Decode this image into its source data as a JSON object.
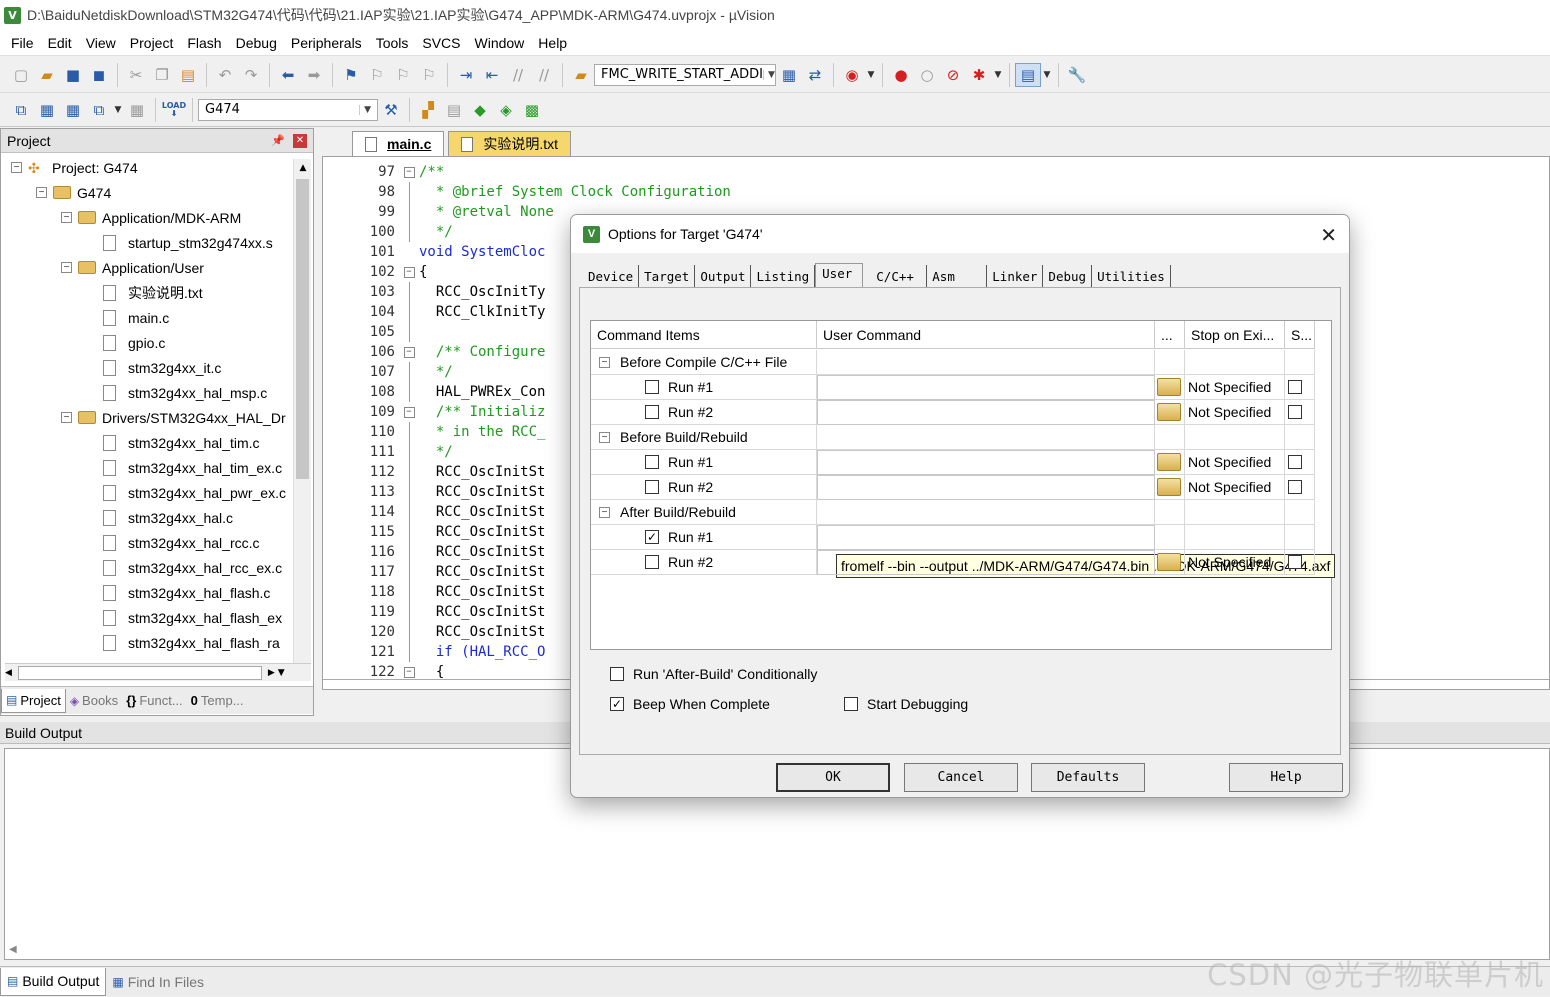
{
  "window": {
    "title": "D:\\BaiduNetdiskDownload\\STM32G474\\代码\\代码\\21.IAP实验\\21.IAP实验\\G474_APP\\MDK-ARM\\G474.uvprojx - µVision",
    "icon": "V"
  },
  "menu": [
    "File",
    "Edit",
    "View",
    "Project",
    "Flash",
    "Debug",
    "Peripherals",
    "Tools",
    "SVCS",
    "Window",
    "Help"
  ],
  "toolbar": {
    "search_combo": "FMC_WRITE_START_ADDI",
    "target_combo": "G474",
    "load_label": "LOAD"
  },
  "project_pane": {
    "title": "Project",
    "tree": [
      {
        "label": "Project: G474",
        "level": 0,
        "kind": "project",
        "expander": "-"
      },
      {
        "label": "G474",
        "level": 1,
        "kind": "target",
        "expander": "-"
      },
      {
        "label": "Application/MDK-ARM",
        "level": 2,
        "kind": "folder",
        "expander": "-"
      },
      {
        "label": "startup_stm32g474xx.s",
        "level": 3,
        "kind": "file"
      },
      {
        "label": "Application/User",
        "level": 2,
        "kind": "folder",
        "expander": "-"
      },
      {
        "label": "实验说明.txt",
        "level": 3,
        "kind": "file"
      },
      {
        "label": "main.c",
        "level": 3,
        "kind": "file"
      },
      {
        "label": "gpio.c",
        "level": 3,
        "kind": "file"
      },
      {
        "label": "stm32g4xx_it.c",
        "level": 3,
        "kind": "file"
      },
      {
        "label": "stm32g4xx_hal_msp.c",
        "level": 3,
        "kind": "file"
      },
      {
        "label": "Drivers/STM32G4xx_HAL_Dr",
        "level": 2,
        "kind": "folder",
        "expander": "-"
      },
      {
        "label": "stm32g4xx_hal_tim.c",
        "level": 3,
        "kind": "file"
      },
      {
        "label": "stm32g4xx_hal_tim_ex.c",
        "level": 3,
        "kind": "file"
      },
      {
        "label": "stm32g4xx_hal_pwr_ex.c",
        "level": 3,
        "kind": "file"
      },
      {
        "label": "stm32g4xx_hal.c",
        "level": 3,
        "kind": "file"
      },
      {
        "label": "stm32g4xx_hal_rcc.c",
        "level": 3,
        "kind": "file"
      },
      {
        "label": "stm32g4xx_hal_rcc_ex.c",
        "level": 3,
        "kind": "file"
      },
      {
        "label": "stm32g4xx_hal_flash.c",
        "level": 3,
        "kind": "file"
      },
      {
        "label": "stm32g4xx_hal_flash_ex",
        "level": 3,
        "kind": "file"
      },
      {
        "label": "stm32g4xx_hal_flash_ra",
        "level": 3,
        "kind": "file"
      }
    ],
    "tabs": [
      "Project",
      "Books",
      "Funct...",
      "Temp..."
    ]
  },
  "editor": {
    "tabs": [
      {
        "label": "main.c",
        "active": true
      },
      {
        "label": "实验说明.txt",
        "active": false
      }
    ],
    "lines": [
      {
        "n": "97",
        "fold": "box",
        "text": "/**",
        "cls": "com"
      },
      {
        "n": "98",
        "fold": "line",
        "text": "  * @brief System Clock Configuration",
        "cls": "com"
      },
      {
        "n": "99",
        "fold": "line",
        "text": "  * @retval None",
        "cls": "com"
      },
      {
        "n": "100",
        "fold": "end",
        "text": "  */",
        "cls": "com"
      },
      {
        "n": "101",
        "fold": "",
        "text": "void SystemCloc",
        "cls": "kwline"
      },
      {
        "n": "102",
        "fold": "box",
        "text": "{",
        "cls": ""
      },
      {
        "n": "103",
        "fold": "line",
        "text": "  RCC_OscInitTy",
        "cls": ""
      },
      {
        "n": "104",
        "fold": "line",
        "text": "  RCC_ClkInitTy",
        "cls": ""
      },
      {
        "n": "105",
        "fold": "line",
        "text": "",
        "cls": ""
      },
      {
        "n": "106",
        "fold": "box",
        "text": "  /** Configure",
        "cls": "com"
      },
      {
        "n": "107",
        "fold": "line",
        "text": "  */",
        "cls": "com"
      },
      {
        "n": "108",
        "fold": "line",
        "text": "  HAL_PWREx_Con",
        "cls": ""
      },
      {
        "n": "109",
        "fold": "box",
        "text": "  /** Initializ",
        "cls": "com"
      },
      {
        "n": "110",
        "fold": "line",
        "text": "  * in the RCC_",
        "cls": "com"
      },
      {
        "n": "111",
        "fold": "line",
        "text": "  */",
        "cls": "com"
      },
      {
        "n": "112",
        "fold": "line",
        "text": "  RCC_OscInitSt",
        "cls": ""
      },
      {
        "n": "113",
        "fold": "line",
        "text": "  RCC_OscInitSt",
        "cls": ""
      },
      {
        "n": "114",
        "fold": "line",
        "text": "  RCC_OscInitSt",
        "cls": ""
      },
      {
        "n": "115",
        "fold": "line",
        "text": "  RCC_OscInitSt",
        "cls": ""
      },
      {
        "n": "116",
        "fold": "line",
        "text": "  RCC_OscInitSt",
        "cls": ""
      },
      {
        "n": "117",
        "fold": "line",
        "text": "  RCC_OscInitSt",
        "cls": ""
      },
      {
        "n": "118",
        "fold": "line",
        "text": "  RCC_OscInitSt",
        "cls": ""
      },
      {
        "n": "119",
        "fold": "line",
        "text": "  RCC_OscInitSt",
        "cls": ""
      },
      {
        "n": "120",
        "fold": "line",
        "text": "  RCC_OscInitSt",
        "cls": ""
      },
      {
        "n": "121",
        "fold": "line",
        "text": "  if (HAL_RCC_O",
        "cls": "kwline"
      },
      {
        "n": "122",
        "fold": "box",
        "text": "  {",
        "cls": ""
      }
    ]
  },
  "build_output": {
    "title": "Build Output",
    "tabs": [
      "Build Output",
      "Find In Files"
    ]
  },
  "watermark": "CSDN @光子物联单片机",
  "dialog": {
    "title": "Options for Target 'G474'",
    "tabs": [
      "Device",
      "Target",
      "Output",
      "Listing",
      "User",
      "C/C++",
      "Asm",
      "Linker",
      "Debug",
      "Utilities"
    ],
    "active_tab": "User",
    "columns": [
      "Command Items",
      "User Command",
      "...",
      "Stop on Exi...",
      "S..."
    ],
    "rows": [
      {
        "kind": "group",
        "label": "Before Compile C/C++ File"
      },
      {
        "kind": "item",
        "label": "Run #1",
        "checked": false,
        "command": "",
        "stop": "Not Specified"
      },
      {
        "kind": "item",
        "label": "Run #2",
        "checked": false,
        "command": "",
        "stop": "Not Specified"
      },
      {
        "kind": "group",
        "label": "Before Build/Rebuild"
      },
      {
        "kind": "item",
        "label": "Run #1",
        "checked": false,
        "command": "",
        "stop": "Not Specified"
      },
      {
        "kind": "item",
        "label": "Run #2",
        "checked": false,
        "command": "",
        "stop": "Not Specified"
      },
      {
        "kind": "group",
        "label": "After Build/Rebuild"
      },
      {
        "kind": "item",
        "label": "Run #1",
        "checked": true,
        "command": "fromelf --bin --output ../MDK-ARM/G474/G474.bin ../MDK-ARM/G474/G474.axf",
        "stop": ""
      },
      {
        "kind": "item",
        "label": "Run #2",
        "checked": false,
        "command": "",
        "stop": "Not Specified"
      }
    ],
    "options": [
      {
        "label": "Run 'After-Build' Conditionally",
        "checked": false
      },
      {
        "label": "Beep When Complete",
        "checked": true
      },
      {
        "label": "Start Debugging",
        "checked": false
      }
    ],
    "buttons": [
      "OK",
      "Cancel",
      "Defaults",
      "Help"
    ]
  }
}
